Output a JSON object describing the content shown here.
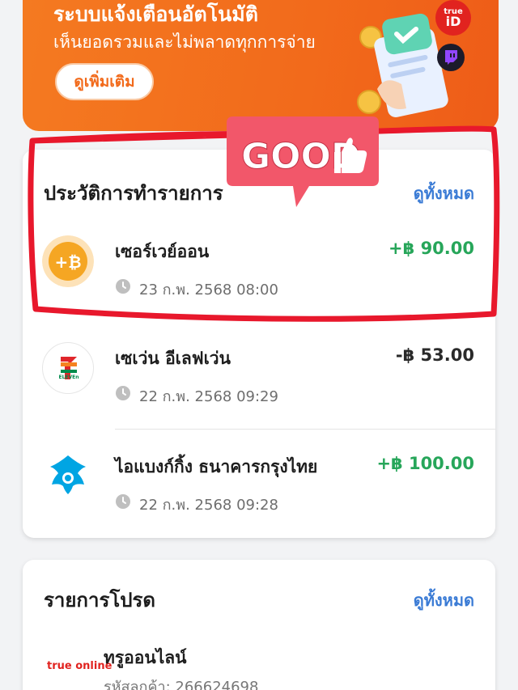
{
  "banner": {
    "title": "ระบบแจ้งเตือนอัตโนมัติ",
    "subtitle": "เห็นยอดรวมและไม่พลาดทุกการจ่าย",
    "button_label": "ดูเพิ่มเติม",
    "trueid_top": "true",
    "trueid_bottom": "iD"
  },
  "sticker": {
    "text": "GOOD"
  },
  "history": {
    "title": "ประวัติการทำรายการ",
    "see_all": "ดูทั้งหมด",
    "transactions": [
      {
        "name": "เซอร์เวย์ออน",
        "amount": "+฿ 90.00",
        "date": "23 ก.พ. 2568 08:00",
        "icon": "bitcoin-coin-icon"
      },
      {
        "name": "เซเว่น อีเลฟเว่น",
        "amount": "-฿ 53.00",
        "date": "22 ก.พ. 2568 09:29",
        "icon": "seven-eleven-logo"
      },
      {
        "name": "ไอแบงก์กิ้ง  ธนาคารกรุงไทย",
        "amount": "+฿ 100.00",
        "date": "22 ก.พ. 2568 09:28",
        "icon": "krungthai-logo"
      }
    ]
  },
  "promo": {
    "title": "รายการโปรด",
    "see_all": "ดูทั้งหมด",
    "items": [
      {
        "logo": "true online",
        "name": "ทรูออนไลน์",
        "subtitle": "รหัสลูกค้า: 266624698"
      }
    ]
  },
  "colors": {
    "accent_orange": "#f26a1b",
    "positive": "#27a65a",
    "link": "#3a7bd5",
    "highlight_red": "#e8182c"
  }
}
